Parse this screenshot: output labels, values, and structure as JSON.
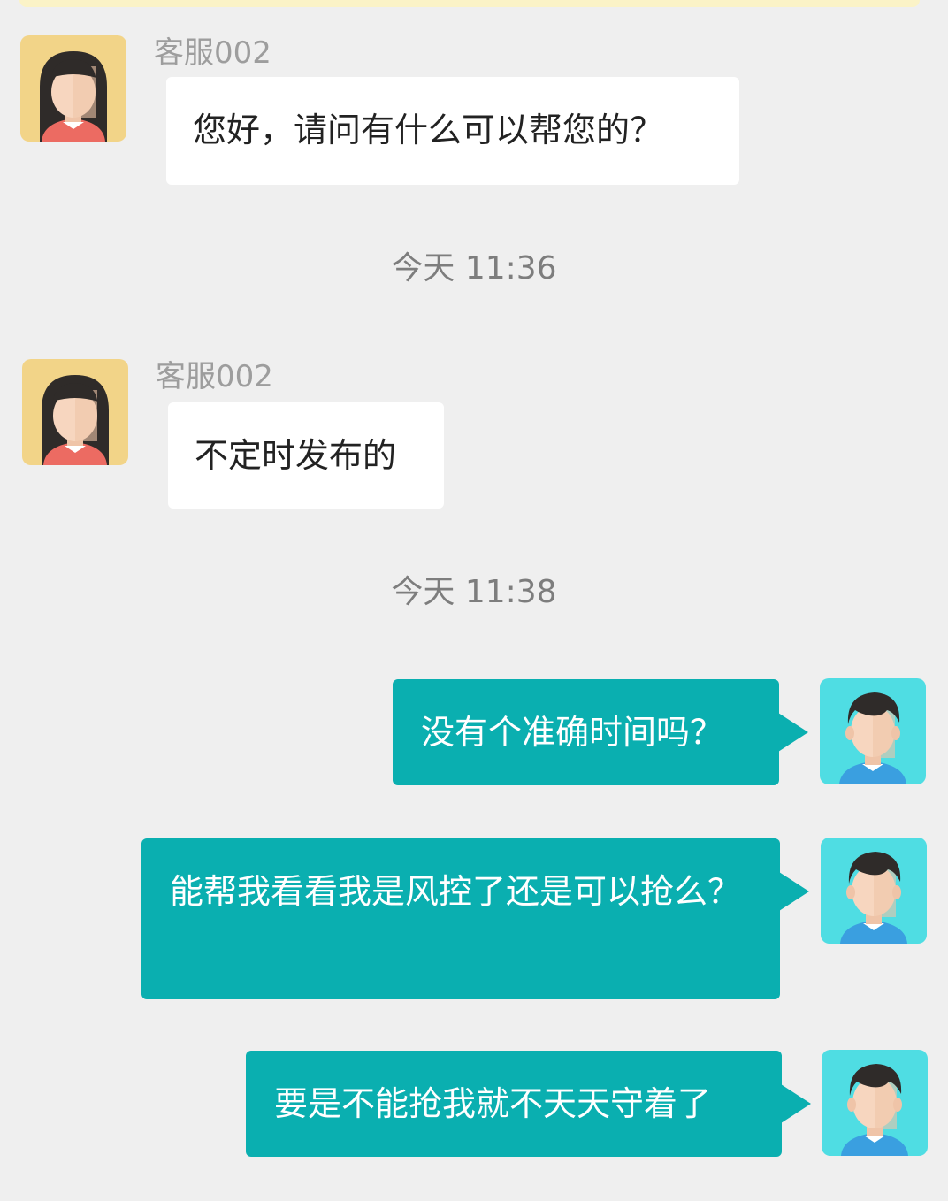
{
  "chat": {
    "messages": [
      {
        "sender": "客服002",
        "side": "left",
        "text": "您好，请问有什么可以帮您的？"
      },
      {
        "sender": "客服002",
        "side": "left",
        "text": "不定时发布的"
      },
      {
        "side": "right",
        "text": "没有个准确时间吗？"
      },
      {
        "side": "right",
        "text": "能帮我看看我是风控了还是可以抢么？"
      },
      {
        "side": "right",
        "text": "要是不能抢我就不天天守着了"
      }
    ],
    "timestamps": [
      "今天 11:36",
      "今天 11:38"
    ]
  },
  "icons": {
    "agent_avatar": "girl-avatar-icon",
    "user_avatar": "boy-avatar-icon"
  },
  "colors": {
    "background": "#efefef",
    "agent_bubble": "#ffffff",
    "user_bubble": "#0aafb0",
    "agent_avatar_bg": "#f2d488",
    "user_avatar_bg": "#4fdde3"
  }
}
